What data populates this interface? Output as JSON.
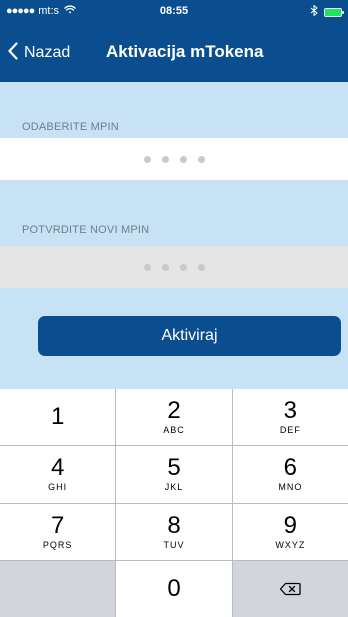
{
  "status_bar": {
    "carrier": "mt:s",
    "signal_dots": "●●●●●",
    "time": "08:55",
    "battery_level_percent": 100
  },
  "nav": {
    "back_label": "Nazad",
    "title": "Aktivacija mTokena"
  },
  "form": {
    "mpin_label": "ODABERITE MPIN",
    "confirm_label": "POTVRDITE NOVI MPIN",
    "activate_button": "Aktiviraj",
    "mpin_dot_count": 4,
    "confirm_dot_count": 4
  },
  "keypad": {
    "keys": [
      {
        "number": "1",
        "letters": ""
      },
      {
        "number": "2",
        "letters": "ABC"
      },
      {
        "number": "3",
        "letters": "DEF"
      },
      {
        "number": "4",
        "letters": "GHI"
      },
      {
        "number": "5",
        "letters": "JKL"
      },
      {
        "number": "6",
        "letters": "MNO"
      },
      {
        "number": "7",
        "letters": "PQRS"
      },
      {
        "number": "8",
        "letters": "TUV"
      },
      {
        "number": "9",
        "letters": "WXYZ"
      },
      {
        "number": "",
        "letters": ""
      },
      {
        "number": "0",
        "letters": ""
      }
    ]
  },
  "colors": {
    "header_blue": "#0b4e8f",
    "content_light_blue": "#c7e2f4",
    "field_gray": "#e5e5e5",
    "field_white": "#ffffff",
    "battery_green": "#1de560"
  },
  "icons": {
    "back": "chevron-left-icon",
    "wifi": "wifi-icon",
    "bluetooth": "bluetooth-icon",
    "battery": "battery-icon",
    "delete": "backspace-icon"
  }
}
